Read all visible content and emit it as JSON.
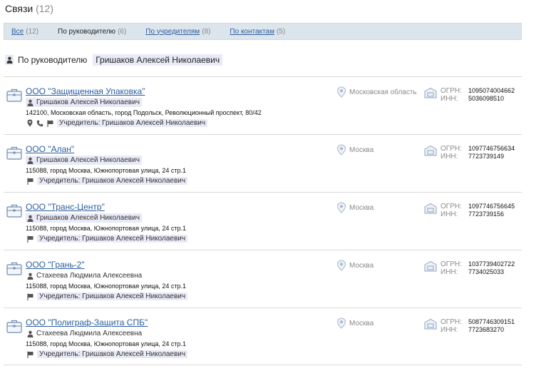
{
  "page": {
    "title": "Связи",
    "count": "(12)"
  },
  "tabs": [
    {
      "label": "Все",
      "count": "(12)",
      "active": false
    },
    {
      "label": "По руководителю",
      "count": "(6)",
      "active": true
    },
    {
      "label": "По учредителям",
      "count": "(8)",
      "active": false
    },
    {
      "label": "По контактам",
      "count": "(5)",
      "active": false
    }
  ],
  "filter": {
    "label": "По руководителю",
    "value": "Гришаков Алексей Николаевич"
  },
  "labels": {
    "ogrn": "ОГРН:",
    "inn": "ИНН:"
  },
  "organizations": [
    {
      "name": "ООО \"Защищенная Упаковка\"",
      "director": "Гришаков Алексей Николаевич",
      "director_highlighted": true,
      "address": "142100, Московская область, город Подольск, Революционный проспект, 80/42",
      "has_location": true,
      "has_phone": true,
      "founder": "Учредитель: Гришаков Алексей Николаевич",
      "region": "Московская область",
      "ogrn": "1095074004662",
      "inn": "5036098510"
    },
    {
      "name": "ООО \"Алан\"",
      "director": "Гришаков Алексей Николаевич",
      "director_highlighted": true,
      "address": "115088, город Москва, Южнопортовая улица, 24 стр.1",
      "has_location": false,
      "has_phone": false,
      "founder": "Учредитель: Гришаков Алексей Николаевич",
      "region": "Москва",
      "ogrn": "1097746756634",
      "inn": "7723739149"
    },
    {
      "name": "ООО \"Транс-Центр\"",
      "director": "Гришаков Алексей Николаевич",
      "director_highlighted": true,
      "address": "115088, город Москва, Южнопортовая улица, 24 стр.1",
      "has_location": false,
      "has_phone": false,
      "founder": "Учредитель: Гришаков Алексей Николаевич",
      "region": "Москва",
      "ogrn": "1097746756645",
      "inn": "7723739156"
    },
    {
      "name": "ООО \"Грань-2\"",
      "director": "Стахеева Людмила Алексеевна",
      "director_highlighted": false,
      "address": "115088, город Москва, Южнопортовая улица, 24 стр.1",
      "has_location": false,
      "has_phone": false,
      "founder": "Учредитель: Гришаков Алексей Николаевич",
      "region": "Москва",
      "ogrn": "1037739402722",
      "inn": "7734025033"
    },
    {
      "name": "ООО \"Полиграф-Защита СПБ\"",
      "director": "Стахеева Людмила Алексеевна",
      "director_highlighted": false,
      "address": "115088, город Москва, Южнопортовая улица, 24 стр.1",
      "has_location": false,
      "has_phone": false,
      "founder": "Учредитель: Гришаков Алексей Николаевич",
      "region": "Москва",
      "ogrn": "5087746309151",
      "inn": "7723683270"
    }
  ],
  "icons": {
    "company": "briefcase-icon",
    "person": "person-icon",
    "location": "map-pin-icon",
    "phone": "phone-icon",
    "founder": "flag-icon",
    "registry": "building-doc-icon"
  },
  "colors": {
    "link": "#2a5d9f",
    "tab_bar": "#dde5ec",
    "highlight": "#e9eaf7",
    "muted": "#8a8a8a"
  }
}
